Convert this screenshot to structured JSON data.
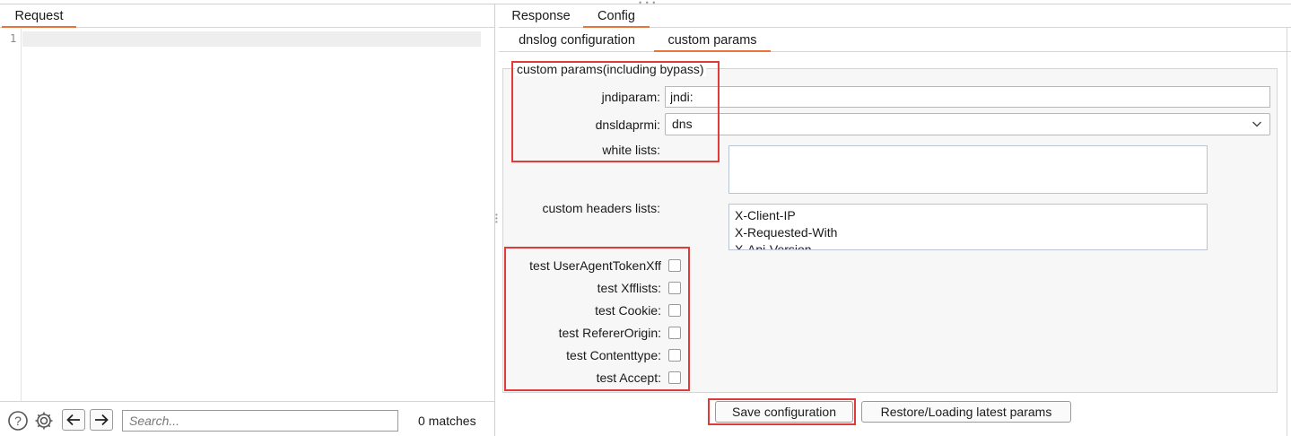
{
  "left": {
    "tab_request": "Request",
    "line_number": "1",
    "search_placeholder": "Search...",
    "matches": "0 matches"
  },
  "right": {
    "tab_response": "Response",
    "tab_config": "Config",
    "subtab_dnslog": "dnslog configuration",
    "subtab_custom": "custom params",
    "group_title": "custom params(including bypass)",
    "jndiparam_label": "jndiparam:",
    "jndiparam_value": "jndi:",
    "dnsldaprmi_label": "dnsldaprmi:",
    "dnsldaprmi_value": "dns",
    "whitelists_label": "white lists:",
    "custom_headers_label": "custom headers lists:",
    "custom_headers": [
      "X-Client-IP",
      "X-Requested-With",
      "X-Api-Version"
    ],
    "checkboxes": [
      {
        "label": "test UserAgentTokenXff",
        "checked": false
      },
      {
        "label": "test Xfflists:",
        "checked": false
      },
      {
        "label": "test Cookie:",
        "checked": false
      },
      {
        "label": "test RefererOrigin:",
        "checked": false
      },
      {
        "label": "test Contenttype:",
        "checked": false
      },
      {
        "label": "test Accept:",
        "checked": false
      }
    ],
    "save_button": "Save configuration",
    "restore_button": "Restore/Loading latest params"
  },
  "colors": {
    "accent_tab": "#e8743b",
    "highlight_box": "#e03a3a"
  },
  "icons": [
    "help-icon",
    "gear-icon",
    "arrow-left-icon",
    "arrow-right-icon",
    "chevron-down-icon"
  ]
}
